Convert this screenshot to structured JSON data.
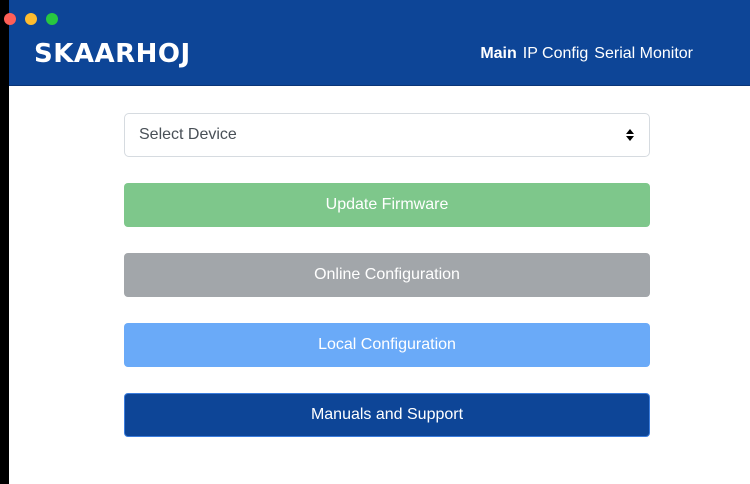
{
  "window": {
    "controls": [
      "close",
      "minimize",
      "zoom"
    ]
  },
  "header": {
    "brand": "SKAARHOJ",
    "nav": {
      "main": "Main",
      "ip_config": "IP Config",
      "serial_monitor": "Serial Monitor"
    },
    "active_tab": "Main"
  },
  "device_select": {
    "value": "Select Device",
    "icon": "up-down-arrows-icon"
  },
  "buttons": {
    "update_firmware": "Update Firmware",
    "online_configuration": "Online Configuration",
    "local_configuration": "Local Configuration",
    "manuals_support": "Manuals and Support"
  },
  "colors": {
    "header_bg": "#0d4597",
    "update_firmware": "#7ec78b",
    "online_configuration": "#a2a6aa",
    "local_configuration": "#6aaaf8",
    "manuals_support": "#0d4597"
  }
}
